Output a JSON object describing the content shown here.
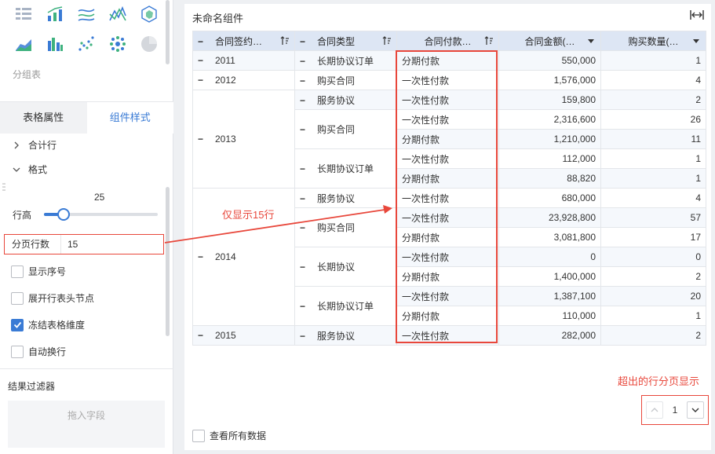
{
  "left_panel": {
    "chart_icons": [
      "matrix-chart-icon",
      "bar-line-chart-icon",
      "multi-line-chart-icon",
      "line-chart-icon",
      "radar-chart-icon",
      "area-chart-icon",
      "grouped-bar-chart-icon",
      "scatter-chart-icon",
      "bubble-chart-icon",
      "pie-chart-icon"
    ],
    "group_label": "分组表",
    "tabs": [
      "表格属性",
      "组件样式"
    ],
    "active_tab": "组件样式",
    "total_row_label": "合计行",
    "format_label": "格式",
    "row_height": {
      "label": "行高",
      "value": "25",
      "fraction": 0.17
    },
    "page_rows": {
      "label": "分页行数",
      "value": "15"
    },
    "checkboxes": [
      {
        "label": "显示序号",
        "checked": false
      },
      {
        "label": "展开行表头节点",
        "checked": false
      },
      {
        "label": "冻结表格维度",
        "checked": true
      },
      {
        "label": "自动换行",
        "checked": false
      }
    ],
    "filter_title": "结果过滤器",
    "dropzone_text": "拖入字段",
    "accent_color": "#3a7bd5"
  },
  "main": {
    "title": "未命名组件",
    "headers": [
      "合同签约…",
      "合同类型",
      "合同付款…",
      "合同金额(…",
      "购买数量(…"
    ],
    "rows": [
      {
        "year": "2011",
        "type": "长期协议订单",
        "pay": "分期付款",
        "amount": "550,000",
        "qty": "1"
      },
      {
        "year": "2012",
        "type": "购买合同",
        "pay": "一次性付款",
        "amount": "1,576,000",
        "qty": "4"
      },
      {
        "year": "2013",
        "type": "服务协议",
        "pay": "一次性付款",
        "amount": "159,800",
        "qty": "2"
      },
      {
        "year": "",
        "type": "购买合同",
        "pay": "一次性付款",
        "amount": "2,316,600",
        "qty": "26"
      },
      {
        "year": "",
        "type": "",
        "pay": "分期付款",
        "amount": "1,210,000",
        "qty": "11"
      },
      {
        "year": "",
        "type": "长期协议订单",
        "pay": "一次性付款",
        "amount": "112,000",
        "qty": "1"
      },
      {
        "year": "",
        "type": "",
        "pay": "分期付款",
        "amount": "88,820",
        "qty": "1"
      },
      {
        "year": "2014",
        "type": "服务协议",
        "pay": "一次性付款",
        "amount": "680,000",
        "qty": "4"
      },
      {
        "year": "",
        "type": "购买合同",
        "pay": "一次性付款",
        "amount": "23,928,800",
        "qty": "57"
      },
      {
        "year": "",
        "type": "",
        "pay": "分期付款",
        "amount": "3,081,800",
        "qty": "17"
      },
      {
        "year": "",
        "type": "长期协议",
        "pay": "一次性付款",
        "amount": "0",
        "qty": "0"
      },
      {
        "year": "",
        "type": "",
        "pay": "分期付款",
        "amount": "1,400,000",
        "qty": "2"
      },
      {
        "year": "",
        "type": "长期协议订单",
        "pay": "一次性付款",
        "amount": "1,387,100",
        "qty": "20"
      },
      {
        "year": "",
        "type": "",
        "pay": "分期付款",
        "amount": "110,000",
        "qty": "1"
      },
      {
        "year": "2015",
        "type": "服务协议",
        "pay": "一次性付款",
        "amount": "282,000",
        "qty": "2"
      }
    ],
    "annotation_rows": "仅显示15行",
    "annotation_paging": "超出的行分页显示",
    "current_page": "1",
    "view_all_label": "查看所有数据",
    "highlight_color": "#e8473b"
  }
}
